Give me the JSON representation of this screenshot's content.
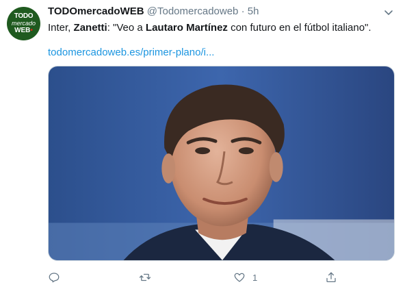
{
  "author": {
    "avatar_text_top": "TODO",
    "avatar_text_mid": "mercado",
    "avatar_text_bottom": "WEB",
    "display_name": "TODOmercadoWEB",
    "handle": "@Todomercadoweb",
    "separator": "·",
    "time": "5h"
  },
  "tweet": {
    "t1": "Inter, ",
    "t2": "Zanetti",
    "t3": ": \"Veo a ",
    "t4": "Lautaro Martínez",
    "t5": " con futuro en el fútbol italiano\".",
    "link": "todomercadoweb.es/primer-plano/i..."
  },
  "actions": {
    "reply_icon": "reply-icon",
    "retweet_icon": "retweet-icon",
    "like_icon": "heart-icon",
    "like_count": "1",
    "share_icon": "share-icon"
  },
  "colors": {
    "text": "#14171a",
    "muted": "#657786",
    "link": "#1b95e0",
    "avatar_bg": "#1f5a1f"
  }
}
